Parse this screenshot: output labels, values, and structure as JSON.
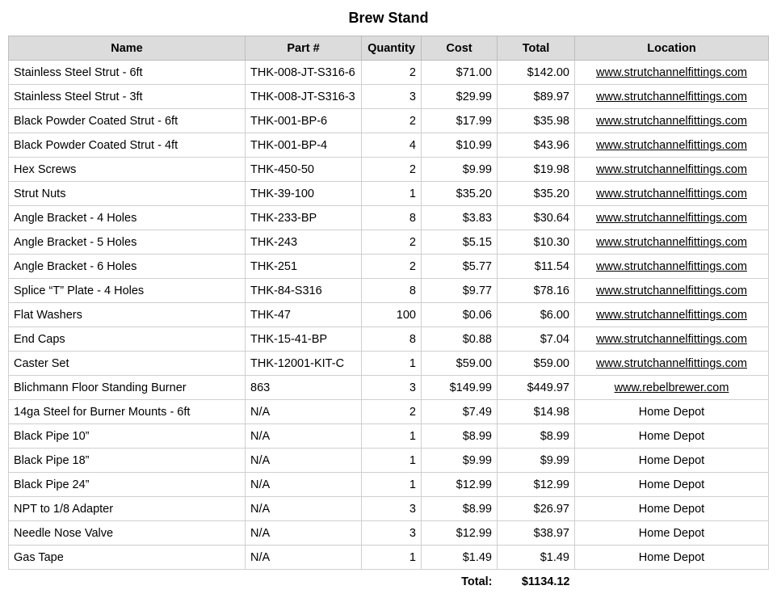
{
  "title": "Brew Stand",
  "columns": [
    "Name",
    "Part #",
    "Quantity",
    "Cost",
    "Total",
    "Location"
  ],
  "rows": [
    {
      "name": "Stainless Steel Strut - 6ft",
      "part": "THK-008-JT-S316-6",
      "qty": "2",
      "cost": "$71.00",
      "total": "$142.00",
      "location": "www.strutchannelfittings.com"
    },
    {
      "name": "Stainless Steel Strut - 3ft",
      "part": "THK-008-JT-S316-3",
      "qty": "3",
      "cost": "$29.99",
      "total": "$89.97",
      "location": "www.strutchannelfittings.com"
    },
    {
      "name": "Black Powder Coated Strut - 6ft",
      "part": "THK-001-BP-6",
      "qty": "2",
      "cost": "$17.99",
      "total": "$35.98",
      "location": "www.strutchannelfittings.com"
    },
    {
      "name": "Black Powder Coated Strut - 4ft",
      "part": "THK-001-BP-4",
      "qty": "4",
      "cost": "$10.99",
      "total": "$43.96",
      "location": "www.strutchannelfittings.com"
    },
    {
      "name": "Hex Screws",
      "part": "THK-450-50",
      "qty": "2",
      "cost": "$9.99",
      "total": "$19.98",
      "location": "www.strutchannelfittings.com"
    },
    {
      "name": "Strut Nuts",
      "part": "THK-39-100",
      "qty": "1",
      "cost": "$35.20",
      "total": "$35.20",
      "location": "www.strutchannelfittings.com"
    },
    {
      "name": "Angle Bracket - 4 Holes",
      "part": "THK-233-BP",
      "qty": "8",
      "cost": "$3.83",
      "total": "$30.64",
      "location": "www.strutchannelfittings.com"
    },
    {
      "name": "Angle Bracket - 5 Holes",
      "part": "THK-243",
      "qty": "2",
      "cost": "$5.15",
      "total": "$10.30",
      "location": "www.strutchannelfittings.com"
    },
    {
      "name": "Angle Bracket - 6 Holes",
      "part": "THK-251",
      "qty": "2",
      "cost": "$5.77",
      "total": "$11.54",
      "location": "www.strutchannelfittings.com"
    },
    {
      "name": "Splice “T” Plate - 4 Holes",
      "part": "THK-84-S316",
      "qty": "8",
      "cost": "$9.77",
      "total": "$78.16",
      "location": "www.strutchannelfittings.com"
    },
    {
      "name": "Flat Washers",
      "part": "THK-47",
      "qty": "100",
      "cost": "$0.06",
      "total": "$6.00",
      "location": "www.strutchannelfittings.com"
    },
    {
      "name": "End Caps",
      "part": "THK-15-41-BP",
      "qty": "8",
      "cost": "$0.88",
      "total": "$7.04",
      "location": "www.strutchannelfittings.com"
    },
    {
      "name": "Caster Set",
      "part": "THK-12001-KIT-C",
      "qty": "1",
      "cost": "$59.00",
      "total": "$59.00",
      "location": "www.strutchannelfittings.com"
    },
    {
      "name": "Blichmann Floor Standing Burner",
      "part": "863",
      "qty": "3",
      "cost": "$149.99",
      "total": "$449.97",
      "location": "www.rebelbrewer.com"
    },
    {
      "name": "14ga Steel for Burner Mounts - 6ft",
      "part": "N/A",
      "qty": "2",
      "cost": "$7.49",
      "total": "$14.98",
      "location": "Home Depot"
    },
    {
      "name": "Black Pipe 10”",
      "part": "N/A",
      "qty": "1",
      "cost": "$8.99",
      "total": "$8.99",
      "location": "Home Depot"
    },
    {
      "name": "Black Pipe 18”",
      "part": "N/A",
      "qty": "1",
      "cost": "$9.99",
      "total": "$9.99",
      "location": "Home Depot"
    },
    {
      "name": "Black Pipe 24”",
      "part": "N/A",
      "qty": "1",
      "cost": "$12.99",
      "total": "$12.99",
      "location": "Home Depot"
    },
    {
      "name": "NPT to 1/8 Adapter",
      "part": "N/A",
      "qty": "3",
      "cost": "$8.99",
      "total": "$26.97",
      "location": "Home Depot"
    },
    {
      "name": "Needle Nose Valve",
      "part": "N/A",
      "qty": "3",
      "cost": "$12.99",
      "total": "$38.97",
      "location": "Home Depot"
    },
    {
      "name": "Gas Tape",
      "part": "N/A",
      "qty": "1",
      "cost": "$1.49",
      "total": "$1.49",
      "location": "Home Depot"
    }
  ],
  "summary": {
    "label": "Total:",
    "value": "$1134.12"
  }
}
